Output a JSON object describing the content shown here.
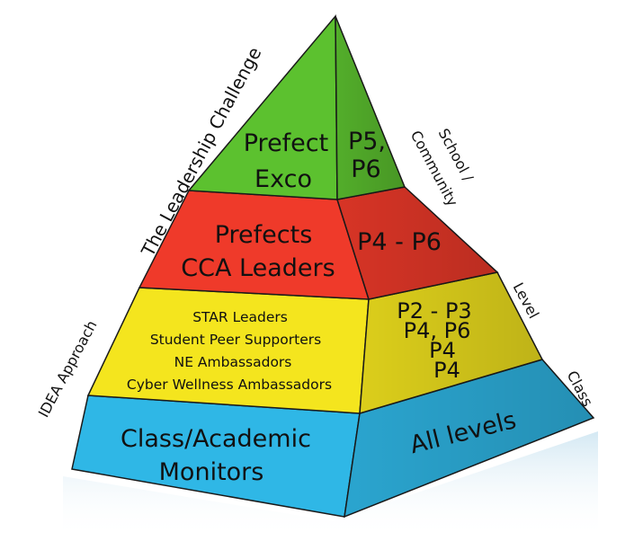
{
  "colors": {
    "green": "#5cc12f",
    "red": "#ef3a2a",
    "yellow": "#f4e51e",
    "blue": "#2fb7e6",
    "outline": "#1a1a1a"
  },
  "tiers": {
    "top": {
      "left": [
        "Prefect",
        "Exco"
      ],
      "right": [
        "P5,",
        "P6"
      ]
    },
    "second": {
      "left": [
        "Prefects",
        "CCA Leaders"
      ],
      "right": [
        "P4 - P6"
      ]
    },
    "third": {
      "left": [
        "STAR Leaders",
        "Student Peer Supporters",
        "NE Ambassadors",
        "Cyber Wellness Ambassadors"
      ],
      "right": [
        "P2 - P3",
        "P4, P6",
        "P4",
        "P4"
      ]
    },
    "base": {
      "left": [
        "Class/Academic",
        "Monitors"
      ],
      "right": [
        "All levels"
      ]
    }
  },
  "side_labels": {
    "leadership_challenge": "The Leadership Challenge",
    "idea_approach": "IDEA Approach",
    "school_community": [
      "School /",
      "Community"
    ],
    "level": "Level",
    "class": "Class"
  }
}
